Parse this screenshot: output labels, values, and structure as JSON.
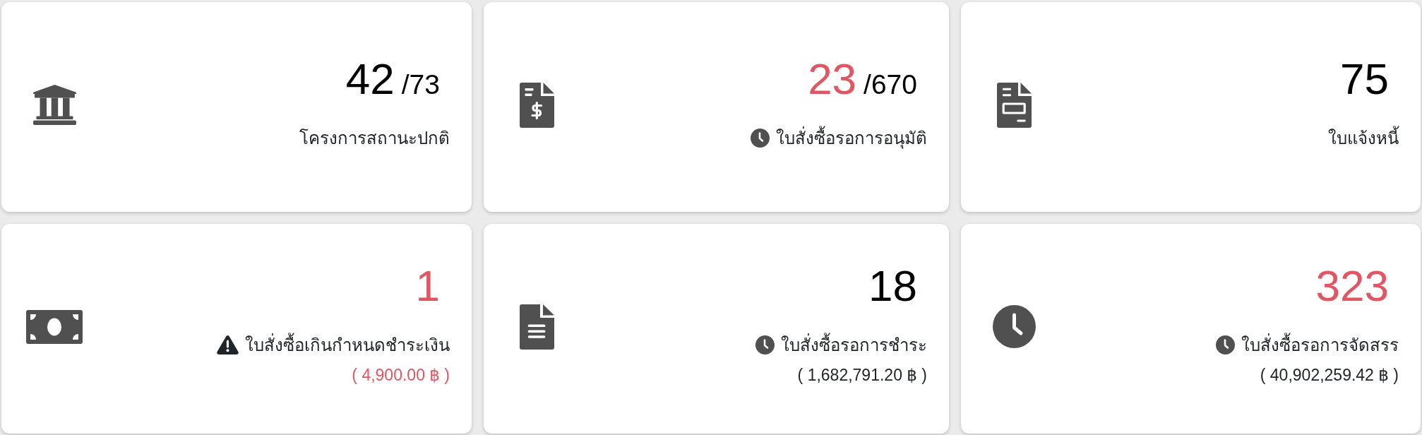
{
  "cards": [
    {
      "kind": "bank",
      "count": "42",
      "count_alert": false,
      "total": "/73",
      "pending": false,
      "overdue": false,
      "label": "โครงการสถานะปกติ"
    },
    {
      "kind": "bill",
      "count": "23",
      "count_alert": true,
      "total": "/670",
      "pending": true,
      "overdue": false,
      "label": "ใบสั่งซื้อรอการอนุมัติ"
    },
    {
      "kind": "notice",
      "count": "75",
      "count_alert": false,
      "pending": false,
      "overdue": false,
      "label": "ใบแจ้งหนี้"
    },
    {
      "kind": "cash",
      "count": "1",
      "count_alert": true,
      "pending": false,
      "overdue": true,
      "label": "ใบสั่งซื้อเกินกำหนดชำระเงิน",
      "amount": "( 4,900.00 ฿ )",
      "amount_alert": true
    },
    {
      "kind": "document",
      "count": "18",
      "count_alert": false,
      "pending": true,
      "overdue": false,
      "label": "ใบสั่งซื้อรอการชำระ",
      "amount": "( 1,682,791.20 ฿ )",
      "amount_alert": false
    },
    {
      "kind": "clock",
      "count": "323",
      "count_alert": true,
      "pending": true,
      "overdue": false,
      "label": "ใบสั่งซื้อรอการจัดสรร",
      "amount": "( 40,902,259.42 ฿ )",
      "amount_alert": false
    }
  ]
}
